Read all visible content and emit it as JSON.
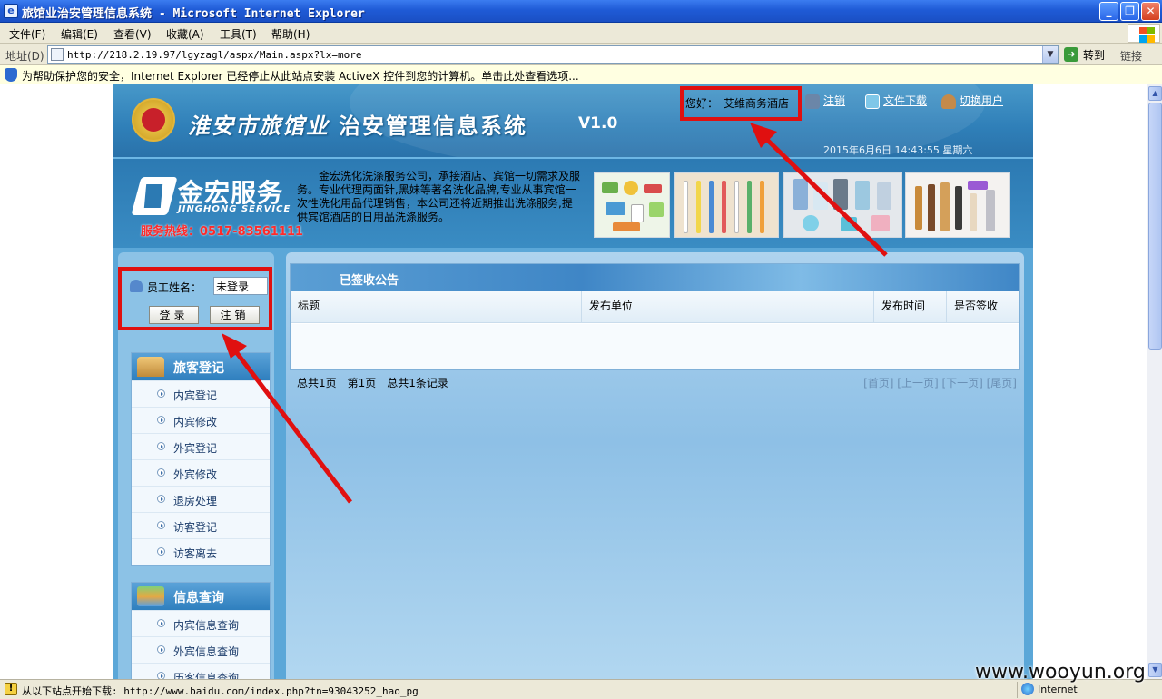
{
  "window": {
    "title": "旅馆业治安管理信息系统 - Microsoft Internet Explorer",
    "min_label": "_",
    "max_label": "❐",
    "close_label": "✕"
  },
  "menubar": {
    "items": [
      "文件(F)",
      "编辑(E)",
      "查看(V)",
      "收藏(A)",
      "工具(T)",
      "帮助(H)"
    ]
  },
  "addressbar": {
    "label": "地址(D)",
    "url": "http://218.2.19.97/lgyzagl/aspx/Main.aspx?lx=more",
    "go_label": "转到",
    "links_label": "链接"
  },
  "infobar": {
    "text": "为帮助保护您的安全，Internet Explorer 已经停止从此站点安装 ActiveX 控件到您的计算机。单击此处查看选项..."
  },
  "header": {
    "calligraphy": "淮安市旅馆业",
    "system_name": "治安管理信息系统",
    "version": "V1.0",
    "greeting_label": "您好：",
    "hotel_name": "艾维商务酒店",
    "logout_link": "注销",
    "download_link": "文件下载",
    "switch_user_link": "切换用户",
    "datetime": "2015年6月6日  14:43:55  星期六"
  },
  "banner": {
    "logo_text": "金宏服务",
    "logo_en": "JINGHONG SERVICE",
    "hotline": "服务热线：0517-83561111",
    "description": "金宏洗化洗涤服务公司，承接酒店、宾馆一切需求及服务。专业代理两面针,黑妹等著名洗化品牌,专业从事宾馆一次性洗化用品代理销售，本公司还将近期推出洗涤服务,提供宾馆酒店的日用品洗涤服务。"
  },
  "login": {
    "employee_label": "员工姓名：",
    "employee_value": "未登录",
    "login_button": "登录",
    "logout_button": "注销"
  },
  "menus": [
    {
      "title": "旅客登记",
      "items": [
        "内宾登记",
        "内宾修改",
        "外宾登记",
        "外宾修改",
        "退房处理",
        "访客登记",
        "访客离去"
      ]
    },
    {
      "title": "信息查询",
      "items": [
        "内宾信息查询",
        "外宾信息查询",
        "历客信息查询"
      ]
    }
  ],
  "notice": {
    "title": "已签收公告",
    "columns": [
      "标题",
      "发布单位",
      "发布时间",
      "是否签收"
    ],
    "total_pages": "总共1页",
    "current_page": "第1页",
    "total_records": "总共1条记录",
    "nav": "[首页] [上一页] [下一页] [尾页]"
  },
  "statusbar": {
    "text": "从以下站点开始下载: http://www.baidu.com/index.php?tn=93043252_hao_pg",
    "zone": "Internet"
  },
  "watermark": "www.wooyun.org",
  "colors": {
    "titlebar": "#1f5bd6",
    "highlight": "#e01010",
    "page_blue": "#2f7fb8"
  }
}
